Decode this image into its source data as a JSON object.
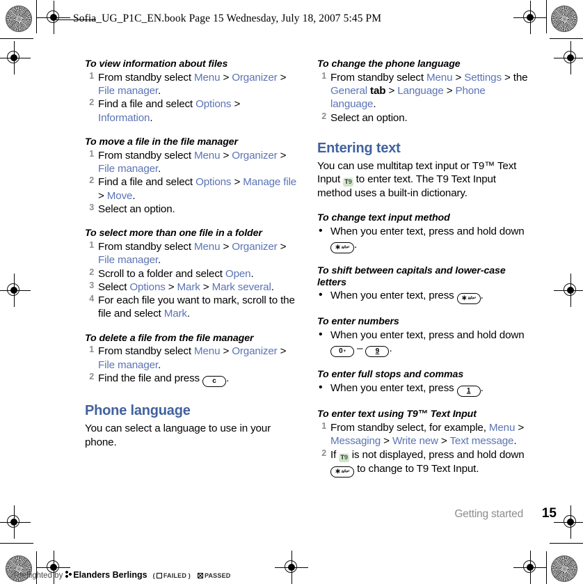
{
  "header": {
    "text": "Sofia_UG_P1C_EN.book  Page 15  Wednesday, July 18, 2007  5:45 PM"
  },
  "footer": {
    "chapter": "Getting started",
    "page_number": "15",
    "preflight_label": "Preflighted by",
    "preflight_brand": "Elanders Berlings",
    "preflight_failed": "FAILED",
    "preflight_passed": "PASSED",
    "paren_open": "(",
    "paren_close": ")"
  },
  "colors": {
    "link": "#5b74b4",
    "heading": "#41619e",
    "marker": "#8e8e8e",
    "body": "#000000"
  },
  "left_column": {
    "procedures": [
      {
        "title": "To view information about files",
        "list_type": "ol",
        "steps": [
          [
            {
              "t": "From standby select ",
              "s": "plain"
            },
            {
              "t": "Menu",
              "s": "link"
            },
            {
              "t": " > ",
              "s": "plain"
            },
            {
              "t": "Organizer",
              "s": "link"
            },
            {
              "t": " > ",
              "s": "plain"
            },
            {
              "t": "File manager",
              "s": "link"
            },
            {
              "t": ".",
              "s": "plain"
            }
          ],
          [
            {
              "t": "Find a file and select ",
              "s": "plain"
            },
            {
              "t": "Options",
              "s": "link"
            },
            {
              "t": " > ",
              "s": "plain"
            },
            {
              "t": "Information",
              "s": "link"
            },
            {
              "t": ".",
              "s": "plain"
            }
          ]
        ]
      },
      {
        "title": "To move a file in the file manager",
        "list_type": "ol",
        "steps": [
          [
            {
              "t": "From standby select ",
              "s": "plain"
            },
            {
              "t": "Menu",
              "s": "link"
            },
            {
              "t": " > ",
              "s": "plain"
            },
            {
              "t": "Organizer",
              "s": "link"
            },
            {
              "t": " > ",
              "s": "plain"
            },
            {
              "t": "File manager",
              "s": "link"
            },
            {
              "t": ".",
              "s": "plain"
            }
          ],
          [
            {
              "t": "Find a file and select ",
              "s": "plain"
            },
            {
              "t": "Options",
              "s": "link"
            },
            {
              "t": " > ",
              "s": "plain"
            },
            {
              "t": "Manage file",
              "s": "link"
            },
            {
              "t": " > ",
              "s": "plain"
            },
            {
              "t": "Move",
              "s": "link"
            },
            {
              "t": ".",
              "s": "plain"
            }
          ],
          [
            {
              "t": "Select an option.",
              "s": "plain"
            }
          ]
        ]
      },
      {
        "title": "To select more than one file in a folder",
        "list_type": "ol",
        "steps": [
          [
            {
              "t": "From standby select ",
              "s": "plain"
            },
            {
              "t": "Menu",
              "s": "link"
            },
            {
              "t": " > ",
              "s": "plain"
            },
            {
              "t": "Organizer",
              "s": "link"
            },
            {
              "t": " > ",
              "s": "plain"
            },
            {
              "t": "File manager",
              "s": "link"
            },
            {
              "t": ".",
              "s": "plain"
            }
          ],
          [
            {
              "t": "Scroll to a folder and select ",
              "s": "plain"
            },
            {
              "t": "Open",
              "s": "link"
            },
            {
              "t": ".",
              "s": "plain"
            }
          ],
          [
            {
              "t": "Select ",
              "s": "plain"
            },
            {
              "t": "Options",
              "s": "link"
            },
            {
              "t": " > ",
              "s": "plain"
            },
            {
              "t": "Mark",
              "s": "link"
            },
            {
              "t": " > ",
              "s": "plain"
            },
            {
              "t": "Mark several",
              "s": "link"
            },
            {
              "t": ".",
              "s": "plain"
            }
          ],
          [
            {
              "t": "For each file you want to mark, scroll to the file and select ",
              "s": "plain"
            },
            {
              "t": "Mark",
              "s": "link"
            },
            {
              "t": ".",
              "s": "plain"
            }
          ]
        ]
      },
      {
        "title": "To delete a file from the file manager",
        "list_type": "ol",
        "steps": [
          [
            {
              "t": "From standby select ",
              "s": "plain"
            },
            {
              "t": "Menu",
              "s": "link"
            },
            {
              "t": " > ",
              "s": "plain"
            },
            {
              "t": "Organizer",
              "s": "link"
            },
            {
              "t": " > ",
              "s": "plain"
            },
            {
              "t": "File manager",
              "s": "link"
            },
            {
              "t": ".",
              "s": "plain"
            }
          ],
          [
            {
              "t": "Find the file and press ",
              "s": "plain"
            },
            {
              "t": "key:c",
              "s": "key",
              "key_main": "c",
              "key_sub": ""
            },
            {
              "t": ".",
              "s": "plain"
            }
          ]
        ]
      }
    ],
    "chapter": {
      "title": "Phone language",
      "body": "You can select a language to use in your phone."
    }
  },
  "right_column": {
    "procedure_language": {
      "title": "To change the phone language",
      "list_type": "ol",
      "steps": [
        [
          {
            "t": "From standby select ",
            "s": "plain"
          },
          {
            "t": "Menu",
            "s": "link"
          },
          {
            "t": " > ",
            "s": "plain"
          },
          {
            "t": "Settings",
            "s": "link"
          },
          {
            "t": " > the ",
            "s": "plain"
          },
          {
            "t": "General",
            "s": "link"
          },
          {
            "t": " tab",
            "s": "bold"
          },
          {
            "t": " > ",
            "s": "plain"
          },
          {
            "t": "Language",
            "s": "link"
          },
          {
            "t": " > ",
            "s": "plain"
          },
          {
            "t": "Phone language",
            "s": "link"
          },
          {
            "t": ".",
            "s": "plain"
          }
        ],
        [
          {
            "t": "Select an option.",
            "s": "plain"
          }
        ]
      ]
    },
    "chapter": {
      "title": "Entering text",
      "body_parts": [
        {
          "t": "You can use multitap text input or T9™ Text Input ",
          "s": "plain"
        },
        {
          "t": "t9-badge",
          "s": "t9"
        },
        {
          "t": " to enter text. The T9 Text Input method uses a built-in dictionary.",
          "s": "plain"
        }
      ]
    },
    "procedures": [
      {
        "title": "To change text input method",
        "list_type": "ul",
        "steps": [
          [
            {
              "t": "When you enter text, press and hold down ",
              "s": "plain"
            },
            {
              "t": "key:star",
              "s": "key",
              "key_main": "∗",
              "key_sub": "aA↵"
            },
            {
              "t": ".",
              "s": "plain"
            }
          ]
        ]
      },
      {
        "title": "To shift between capitals and lower-case letters",
        "list_type": "ul",
        "steps": [
          [
            {
              "t": "When you enter text, press ",
              "s": "plain"
            },
            {
              "t": "key:star",
              "s": "key",
              "key_main": "∗",
              "key_sub": "aA↵"
            },
            {
              "t": ".",
              "s": "plain"
            }
          ]
        ]
      },
      {
        "title": "To enter numbers",
        "list_type": "ul",
        "steps": [
          [
            {
              "t": "When you enter text, press and hold down ",
              "s": "plain"
            },
            {
              "t": "key:0",
              "s": "key",
              "key_main": "0",
              "key_sub": "+"
            },
            {
              "t": " – ",
              "s": "plain"
            },
            {
              "t": "key:9",
              "s": "key",
              "key_main": "9",
              "key_sub": ""
            },
            {
              "t": ".",
              "s": "plain"
            }
          ]
        ]
      },
      {
        "title": "To enter full stops and commas",
        "list_type": "ul",
        "steps": [
          [
            {
              "t": "When you enter text, press ",
              "s": "plain"
            },
            {
              "t": "key:1",
              "s": "key",
              "key_main": "1",
              "key_sub": ""
            },
            {
              "t": ".",
              "s": "plain"
            }
          ]
        ]
      },
      {
        "title": "To enter text using T9™ Text Input",
        "list_type": "ol",
        "steps": [
          [
            {
              "t": "From standby select, for example, ",
              "s": "plain"
            },
            {
              "t": "Menu",
              "s": "link"
            },
            {
              "t": " > ",
              "s": "plain"
            },
            {
              "t": "Messaging",
              "s": "link"
            },
            {
              "t": " > ",
              "s": "plain"
            },
            {
              "t": "Write new",
              "s": "link"
            },
            {
              "t": " > ",
              "s": "plain"
            },
            {
              "t": "Text message",
              "s": "link"
            },
            {
              "t": ".",
              "s": "plain"
            }
          ],
          [
            {
              "t": "If ",
              "s": "plain"
            },
            {
              "t": "t9-badge",
              "s": "t9"
            },
            {
              "t": " is not displayed, press and hold down ",
              "s": "plain"
            },
            {
              "t": "key:star",
              "s": "key",
              "key_main": "∗",
              "key_sub": "aA↵"
            },
            {
              "t": " to change to T9 Text Input.",
              "s": "plain"
            }
          ]
        ]
      }
    ]
  },
  "registration_marks": {
    "starburst_label": "starburst-registration-target",
    "bullseye_label": "bullseye-registration-target"
  }
}
